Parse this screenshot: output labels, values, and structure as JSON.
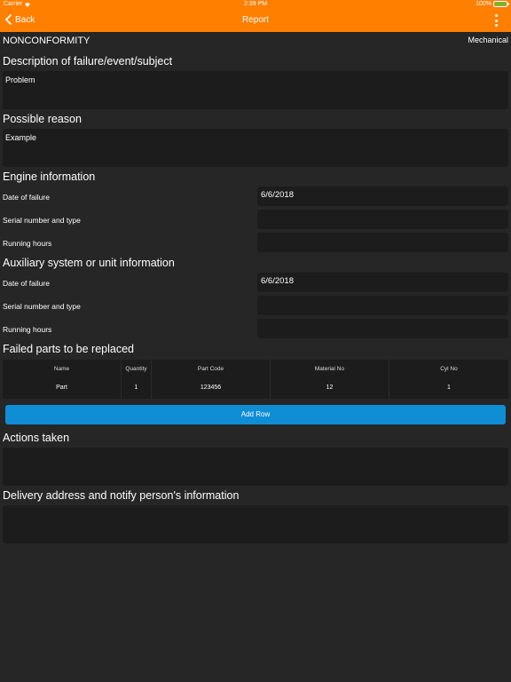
{
  "status_bar": {
    "carrier": "Carrier",
    "time": "2:39 PM",
    "battery": "100%",
    "battery_level": 1.0
  },
  "nav": {
    "back_label": "Back",
    "title": "Report"
  },
  "header": {
    "type_label": "NONCONFORMITY",
    "category": "Mechanical"
  },
  "sections": {
    "description": {
      "title": "Description of failure/event/subject",
      "value": "Problem"
    },
    "possible_reason": {
      "title": "Possible reason",
      "value": "Example"
    },
    "engine": {
      "title": "Engine information",
      "date_label": "Date of failure",
      "date_value": "6/6/2018",
      "serial_label": "Serial number and type",
      "serial_value": "",
      "hours_label": "Running hours",
      "hours_value": ""
    },
    "auxiliary": {
      "title": "Auxiliary system or unit information",
      "date_label": "Date of failure",
      "date_value": "6/6/2018",
      "serial_label": "Serial number and type",
      "serial_value": "",
      "hours_label": "Running hours",
      "hours_value": ""
    },
    "failed_parts": {
      "title": "Failed parts to be replaced",
      "columns": [
        "Name",
        "Quantity",
        "Part Code",
        "Material No",
        "Cyl No"
      ],
      "rows": [
        [
          "Part",
          "1",
          "123456",
          "12",
          "1"
        ]
      ],
      "add_row_label": "Add Row"
    },
    "actions": {
      "title": "Actions taken",
      "value": ""
    },
    "delivery": {
      "title": "Delivery address and notify person's information",
      "value": ""
    }
  },
  "colors": {
    "accent": "#ff7f00",
    "button": "#0f8ed6",
    "background": "#262626",
    "field": "#1c1c1c"
  }
}
